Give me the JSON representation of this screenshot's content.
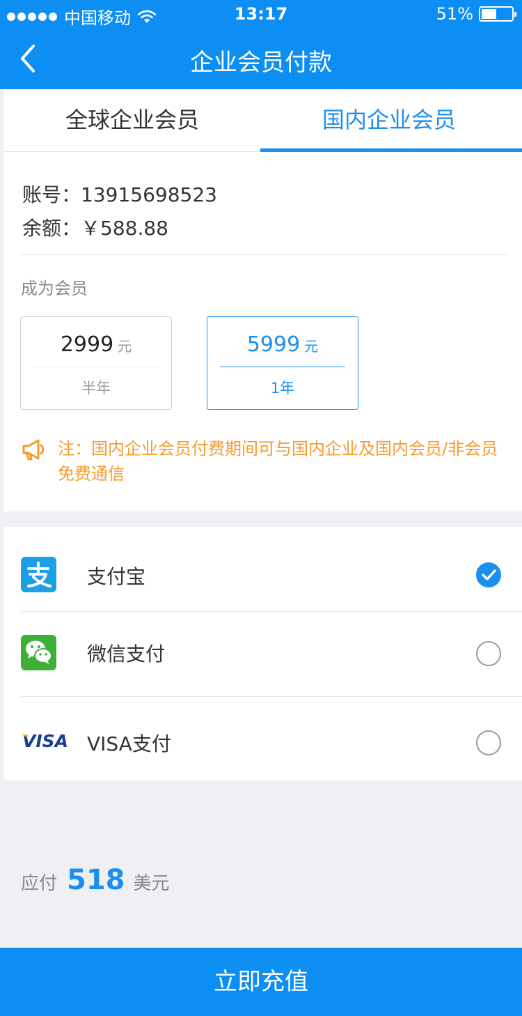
{
  "status_bar": {
    "carrier": "中国移动",
    "time": "13:17",
    "battery_percent": "51%",
    "battery_level": 0.51
  },
  "nav": {
    "title": "企业会员付款"
  },
  "tabs": [
    {
      "label": "全球企业会员",
      "active": false
    },
    {
      "label": "国内企业会员",
      "active": true
    }
  ],
  "account": {
    "account_line": "账号：13915698523",
    "balance_line": "余额：￥588.88"
  },
  "membership": {
    "section_label": "成为会员",
    "plans": [
      {
        "price": "2999",
        "unit": "元",
        "period": "半年",
        "selected": false
      },
      {
        "price": "5999",
        "unit": "元",
        "period": "1年",
        "selected": true
      }
    ]
  },
  "notice": {
    "text": "注：国内企业会员付费期间可与国内企业及国内会员/非会员免费通信"
  },
  "payment_methods": [
    {
      "label": "支付宝",
      "icon": "alipay-icon",
      "checked": true
    },
    {
      "label": "微信支付",
      "icon": "wechat-pay-icon",
      "checked": false
    },
    {
      "label": "VISA支付",
      "icon": "visa-icon",
      "checked": false
    }
  ],
  "total": {
    "label": "应付",
    "amount": "518",
    "unit": "美元"
  },
  "cta": {
    "label": "立即充值"
  },
  "colors": {
    "brand_blue": "#0c8ef2",
    "accent_blue": "#1a8ff0",
    "notice_orange": "#f59b2c",
    "background": "#eff0f4"
  }
}
